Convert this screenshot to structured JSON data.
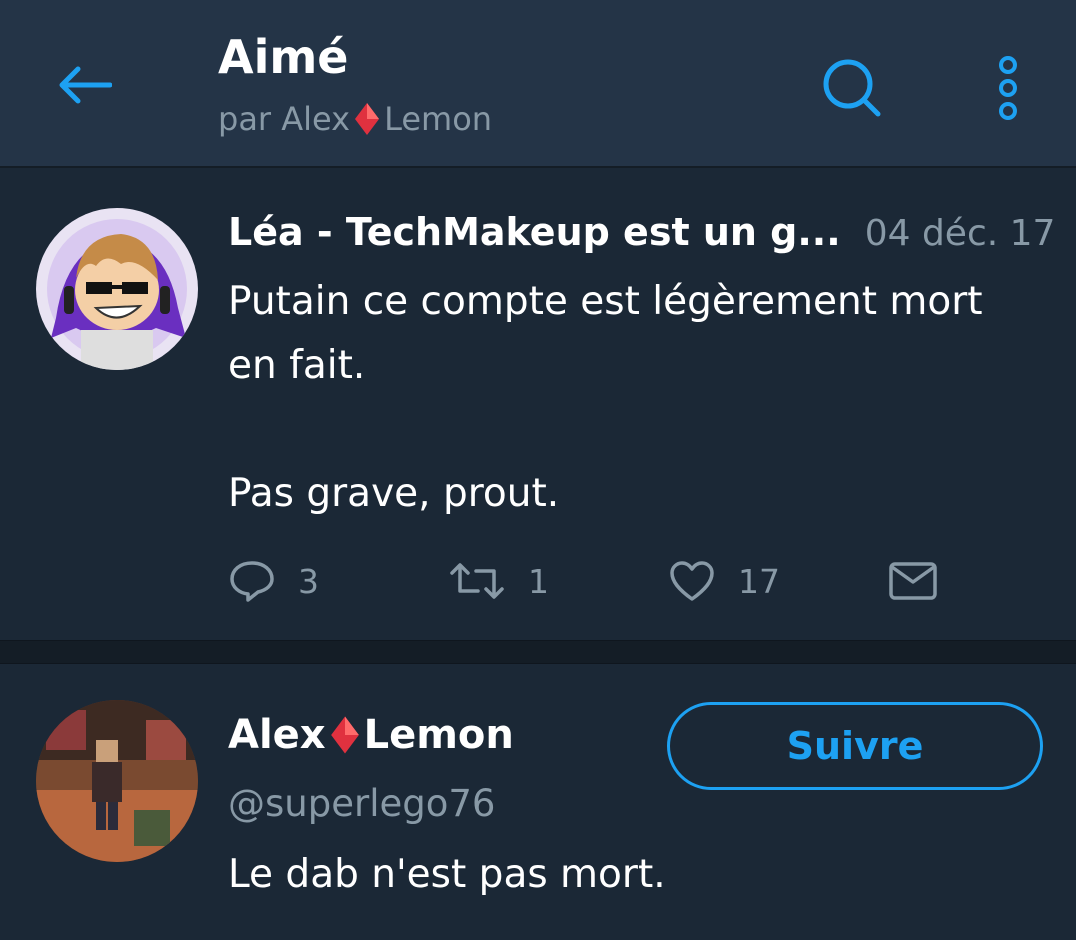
{
  "header": {
    "title": "Aimé",
    "subtitle_prefix": "par Alex",
    "subtitle_suffix": "Lemon",
    "accent_color": "#1da1f2",
    "icons": {
      "back": "arrow-left-icon",
      "search": "search-icon",
      "more": "more-vertical-icon"
    }
  },
  "tweets": [
    {
      "author": "Léa - TechMakeup est un g...",
      "date": "04 déc. 17",
      "text": "Putain ce compte est légèrement mort\nen fait.\n\nPas grave, prout.",
      "actions": {
        "reply_count": "3",
        "retweet_count": "1",
        "like_count": "17"
      }
    },
    {
      "author_prefix": "Alex",
      "author_suffix": "Lemon",
      "handle": "@superlego76",
      "follow_label": "Suivre",
      "text": "Le dab n'est pas mort."
    }
  ]
}
